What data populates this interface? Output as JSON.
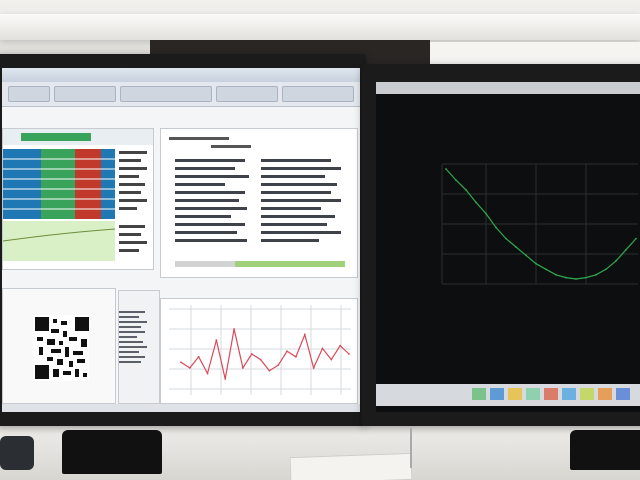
{
  "scene": {
    "left_monitor": {
      "window_title": "",
      "panels": [
        "heatmap",
        "text-report",
        "qr-code",
        "line-chart"
      ]
    },
    "right_monitor": {
      "panels": [
        "dark-line-chart"
      ]
    }
  },
  "colors": {
    "heat_blue": "#1f78b4",
    "heat_green": "#3aa35b",
    "heat_red": "#c0392b",
    "chart_line_red": "#d84a5a",
    "chart_line_green": "#2fa84f",
    "screen_dark": "#0d0e10"
  },
  "chart_data": [
    {
      "type": "line",
      "title": "",
      "xlabel": "",
      "ylabel": "",
      "series": [
        {
          "values": [
            32,
            30,
            34,
            28,
            40,
            26,
            44,
            30,
            35,
            33,
            29,
            31,
            36,
            34,
            42,
            30,
            37,
            33,
            38,
            35
          ]
        }
      ]
    },
    {
      "type": "line",
      "title": "",
      "xlabel": "",
      "ylabel": "",
      "series": [
        {
          "values": [
            90,
            82,
            75,
            66,
            58,
            48,
            40,
            34,
            28,
            22,
            18,
            14,
            12,
            11,
            12,
            14,
            18,
            24,
            32,
            40
          ]
        }
      ]
    }
  ]
}
